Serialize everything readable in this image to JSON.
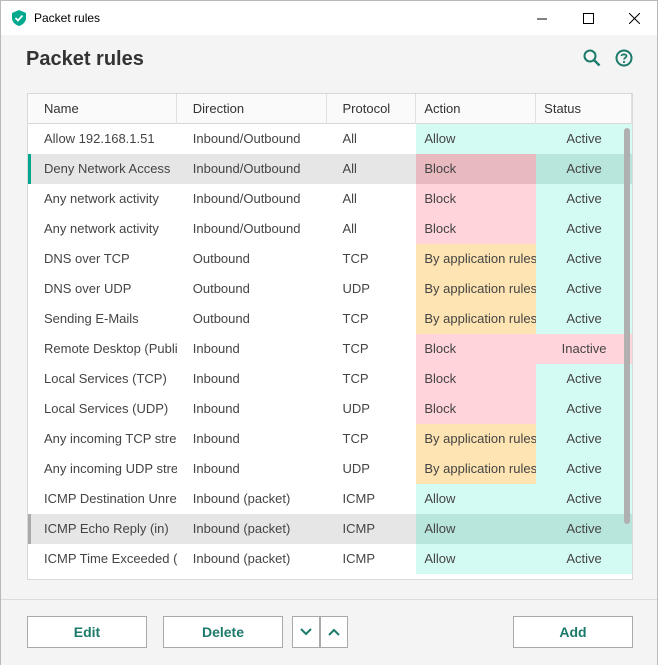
{
  "window": {
    "title": "Packet rules",
    "controls": {
      "minimize": "–",
      "maximize": "☐",
      "close": "✕"
    }
  },
  "header": {
    "title": "Packet rules",
    "search_icon": "search-icon",
    "help_icon": "help-icon"
  },
  "table": {
    "columns": [
      "Name",
      "Direction",
      "Protocol",
      "Action",
      "Status"
    ],
    "rows": [
      {
        "name": "Allow 192.168.1.51",
        "direction": "Inbound/Outbound",
        "protocol": "All",
        "action": "Allow",
        "status": "Active"
      },
      {
        "name": "Deny Network Access",
        "direction": "Inbound/Outbound",
        "protocol": "All",
        "action": "Block",
        "status": "Active"
      },
      {
        "name": "Any network activity",
        "direction": "Inbound/Outbound",
        "protocol": "All",
        "action": "Block",
        "status": "Active"
      },
      {
        "name": "Any network activity",
        "direction": "Inbound/Outbound",
        "protocol": "All",
        "action": "Block",
        "status": "Active"
      },
      {
        "name": "DNS over TCP",
        "direction": "Outbound",
        "protocol": "TCP",
        "action": "By application rules",
        "status": "Active"
      },
      {
        "name": "DNS over UDP",
        "direction": "Outbound",
        "protocol": "UDP",
        "action": "By application rules",
        "status": "Active"
      },
      {
        "name": "Sending E-Mails",
        "direction": "Outbound",
        "protocol": "TCP",
        "action": "By application rules",
        "status": "Active"
      },
      {
        "name": "Remote Desktop (Publi...",
        "direction": "Inbound",
        "protocol": "TCP",
        "action": "Block",
        "status": "Inactive"
      },
      {
        "name": "Local Services (TCP)",
        "direction": "Inbound",
        "protocol": "TCP",
        "action": "Block",
        "status": "Active"
      },
      {
        "name": "Local Services (UDP)",
        "direction": "Inbound",
        "protocol": "UDP",
        "action": "Block",
        "status": "Active"
      },
      {
        "name": "Any incoming TCP stre...",
        "direction": "Inbound",
        "protocol": "TCP",
        "action": "By application rules",
        "status": "Active"
      },
      {
        "name": "Any incoming UDP stre...",
        "direction": "Inbound",
        "protocol": "UDP",
        "action": "By application rules",
        "status": "Active"
      },
      {
        "name": "ICMP Destination Unre...",
        "direction": "Inbound (packet)",
        "protocol": "ICMP",
        "action": "Allow",
        "status": "Active"
      },
      {
        "name": "ICMP Echo Reply (in)",
        "direction": "Inbound (packet)",
        "protocol": "ICMP",
        "action": "Allow",
        "status": "Active"
      },
      {
        "name": "ICMP Time Exceeded (in)",
        "direction": "Inbound (packet)",
        "protocol": "ICMP",
        "action": "Allow",
        "status": "Active"
      }
    ]
  },
  "footer": {
    "edit": "Edit",
    "delete": "Delete",
    "move_down": "⌄",
    "move_up": "⌃",
    "add": "Add"
  },
  "colors": {
    "accent": "#1c7a6a",
    "allow": "#d4fbf3",
    "block": "#ffd4da",
    "by_app": "#fde4b2"
  }
}
